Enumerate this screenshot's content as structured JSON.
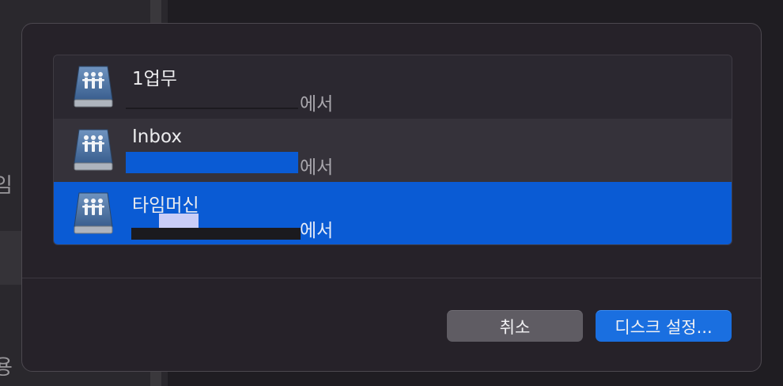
{
  "background": {
    "edge_glyph_1": "임",
    "edge_glyph_2": "용"
  },
  "dialog": {
    "items": [
      {
        "title": "1업무",
        "subtitle": "에서",
        "icon": "network-server-drive-icon"
      },
      {
        "title": "Inbox",
        "subtitle": "에서",
        "icon": "network-server-drive-icon"
      },
      {
        "title": "타임머신",
        "subtitle": "에서",
        "icon": "network-server-drive-icon",
        "selected": true
      }
    ],
    "buttons": {
      "cancel_label": "취소",
      "setup_label": "디스크 설정..."
    }
  },
  "colors": {
    "selection": "#0a5bd4",
    "primary_button": "#1a6fe0",
    "secondary_button": "#5f5c63"
  }
}
